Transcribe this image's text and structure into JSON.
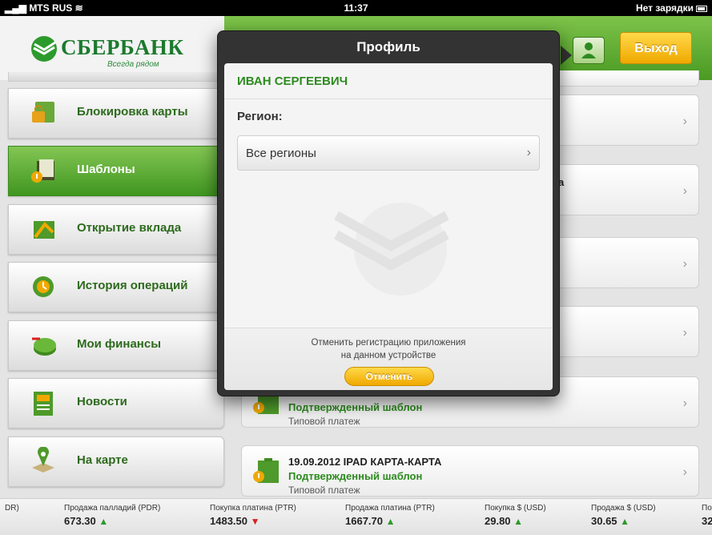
{
  "status_bar": {
    "carrier": "MTS RUS",
    "time": "11:37",
    "battery": "Нет зарядки"
  },
  "brand": {
    "name": "СБЕРБАНК",
    "slogan": "Всегда рядом"
  },
  "header": {
    "logout_label": "Выход"
  },
  "sidebar": {
    "items": [
      {
        "label": "Блокировка карты",
        "icon": "card-lock-icon"
      },
      {
        "label": "Шаблоны",
        "icon": "templates-icon",
        "active": true
      },
      {
        "label": "Открытие вклада",
        "icon": "deposit-icon"
      },
      {
        "label": "История операций",
        "icon": "history-icon"
      },
      {
        "label": "Мои финансы",
        "icon": "finance-pie-icon"
      },
      {
        "label": "Новости",
        "icon": "news-icon"
      },
      {
        "label": "На карте",
        "icon": "map-pin-icon"
      }
    ]
  },
  "templates": {
    "partial_letter": "а",
    "items": [
      {
        "title": "",
        "status": "Подтвержденный шаблон",
        "kind": "Типовой платеж"
      },
      {
        "title": "19.09.2012 IPAD КАРТА-КАРТА",
        "status": "Подтвержденный шаблон",
        "kind": "Типовой платеж"
      }
    ]
  },
  "modal": {
    "title": "Профиль",
    "user_name": "ИВАН СЕРГЕЕВИЧ",
    "region_label": "Регион:",
    "region_value": "Все регионы",
    "footer_line1": "Отменить регистрацию приложения",
    "footer_line2": "на данном устройстве",
    "cancel_label": "Отменить"
  },
  "ticker": [
    {
      "label": "DR)",
      "value": "",
      "dir": ""
    },
    {
      "label": "Продажа палладий (PDR)",
      "value": "673.30",
      "dir": "up"
    },
    {
      "label": "Покупка платина (PTR)",
      "value": "1483.50",
      "dir": "down"
    },
    {
      "label": "Продажа платина (PTR)",
      "value": "1667.70",
      "dir": "up"
    },
    {
      "label": "Покупка $ (USD)",
      "value": "29.80",
      "dir": "up"
    },
    {
      "label": "Продажа $ (USD)",
      "value": "30.65",
      "dir": "up"
    },
    {
      "label": "По",
      "value": "32",
      "dir": ""
    }
  ]
}
